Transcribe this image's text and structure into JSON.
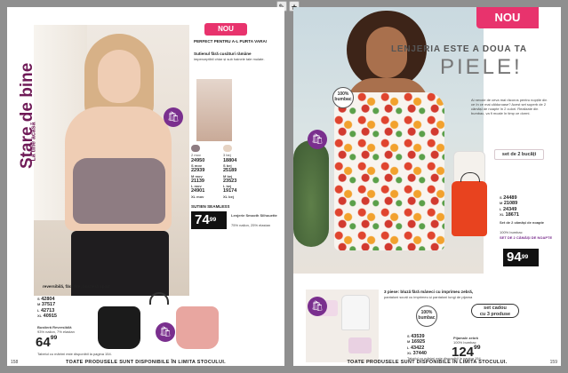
{
  "toolbar": {
    "left_icon": "✎",
    "right_icon": "★"
  },
  "left_page": {
    "section_title": "Stare de bine",
    "section_subtitle": "La tine acasă",
    "nou": "NOU",
    "tagline": "PERFECT PENTRU A-L PURTA VARA!",
    "desc_title": "Sutienul fără cusături rămâne",
    "desc_body": "imperceptibil chiar și sub hainele tale mulate.",
    "colors": [
      {
        "name": "2 mov",
        "hex": "#8e7c82"
      },
      {
        "name": "3 bej",
        "hex": "#e6d3c3"
      }
    ],
    "codes_col1": [
      "24950",
      "22939",
      "21139",
      "24901"
    ],
    "codes_col2": [
      "18804",
      "25189",
      "23523",
      "19174"
    ],
    "sizes_col1": [
      "S mov",
      "M mov",
      "L mov",
      "XL mov"
    ],
    "sizes_col2": [
      "S bej",
      "M bej",
      "L bej",
      "XL bej"
    ],
    "product_label": "SUTIEN SEAMLESS",
    "price_main": "74",
    "price_cents": "99",
    "product_note_title": "Lenjerie Smooth Silhouette",
    "product_note_body": "75% nailon, 25% elastan",
    "bottom_title": "reversibilă, fără fire, bustieră sport",
    "bottom_codes": [
      "42804",
      "37517",
      "42713",
      "40915"
    ],
    "bottom_sizes": [
      "S",
      "M",
      "L",
      "XL"
    ],
    "bottom_product": "Bustieră Reversibilă",
    "bottom_material": "93% nailon, 7% elastan",
    "bottom_price_main": "64",
    "bottom_price_cents": "99",
    "bottom_note": "Tabelul cu mărimi este disponibil la pagina 154.",
    "footer": "TOATE PRODUSELE SUNT DISPONIBILE ÎN LIMITA STOCULUI.",
    "page_number": "158",
    "bag_icon": "🛍"
  },
  "right_page": {
    "nou": "NOU",
    "heading_l1": "LENJERIA ESTE A DOUA TA",
    "heading_l2": "PIELE!",
    "badge_100": "100% bumbac",
    "intro": "Ai nevoie de ceva mai răcoros pentru nopțile din ce în ce mai călduroase? Acest set superb de 2 cămăși de noapte în 2 culori. Realizate din bumbac, va fi moale în timp ce dormi.",
    "set_label": "set de 2 bucăți",
    "codes": [
      "24489",
      "21089",
      "24349",
      "18671"
    ],
    "sizes": [
      "S",
      "M",
      "L",
      "XL"
    ],
    "product_title": "Set de 2 cămăși de noapte",
    "product_material": "100% bumbac",
    "product_name": "SET DE 2 CĂMĂȘI DE NOAPTE",
    "price_main": "94",
    "price_cents": "99",
    "pajama_title": "3 piese: bluză fără mâneci cu imprimeu zebră,",
    "pajama_body": "pantaloni scurți cu imprimeu și pantaloni lungi de pijama",
    "set_gift": "set cadou",
    "set_gift_sub": "cu 3 produse",
    "pajama_codes": [
      "43539",
      "16925",
      "43422",
      "37440"
    ],
    "pajama_sizes": [
      "S",
      "M",
      "L",
      "XL"
    ],
    "pajama_product": "Pijamale zebră",
    "pajama_material": "100% bumbac",
    "pajama_price_main": "124",
    "pajama_price_cents": "99",
    "pajama_note": "Tabelul cu mărimi este disponibil la pagina 154.",
    "footer": "TOATE PRODUSELE SUNT DISPONIBILE ÎN LIMITA STOCULUI.",
    "page_number": "159",
    "bag_icon": "🛍"
  }
}
